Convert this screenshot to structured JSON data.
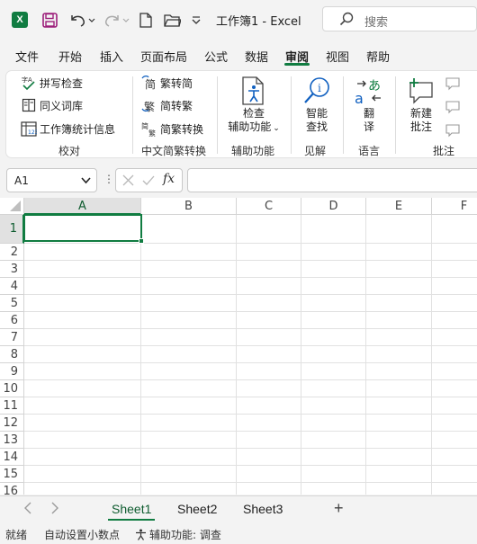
{
  "titlebar": {
    "title": "工作簿1  -  Excel",
    "search_placeholder": "搜索",
    "logo_letter": "X"
  },
  "tabs": [
    {
      "label": "文件"
    },
    {
      "label": "开始"
    },
    {
      "label": "插入"
    },
    {
      "label": "页面布局"
    },
    {
      "label": "公式"
    },
    {
      "label": "数据"
    },
    {
      "label": "审阅"
    },
    {
      "label": "视图"
    },
    {
      "label": "帮助"
    }
  ],
  "active_tab": "审阅",
  "ribbon": {
    "proofing": {
      "spell_check": "拼写检查",
      "thesaurus": "同义词库",
      "stats": "工作簿统计信息",
      "label": "校对"
    },
    "chinese": {
      "to_simplified": "繁转简",
      "to_traditional": "简转繁",
      "convert": "简繁转换",
      "label": "中文简繁转换"
    },
    "accessibility": {
      "check_line1": "检查",
      "check_line2": "辅助功能",
      "label": "辅助功能"
    },
    "insights": {
      "smart_line1": "智能",
      "smart_line2": "查找",
      "label": "见解"
    },
    "language": {
      "translate_line1": "翻",
      "translate_line2": "译",
      "label": "语言"
    },
    "comments": {
      "new_line1": "新建",
      "new_line2": "批注",
      "label": "批注"
    }
  },
  "formula_bar": {
    "name_box": "A1",
    "dots": "⋮",
    "fx": "fx",
    "value": ""
  },
  "grid": {
    "columns": [
      "A",
      "B",
      "C",
      "D",
      "E",
      "F"
    ],
    "rows": [
      "1",
      "2",
      "3",
      "4",
      "5",
      "6",
      "7",
      "8",
      "9",
      "10",
      "11",
      "12",
      "13",
      "14",
      "15",
      "16"
    ]
  },
  "sheets": [
    "Sheet1",
    "Sheet2",
    "Sheet3"
  ],
  "add_sheet": "+",
  "status": {
    "ready": "就绪",
    "auto_decimal": "自动设置小数点",
    "accessibility": "辅助功能: 调查"
  },
  "colors": {
    "accent": "#107c41",
    "text": "#1f1f1f",
    "chrome": "#f3f3f3"
  }
}
